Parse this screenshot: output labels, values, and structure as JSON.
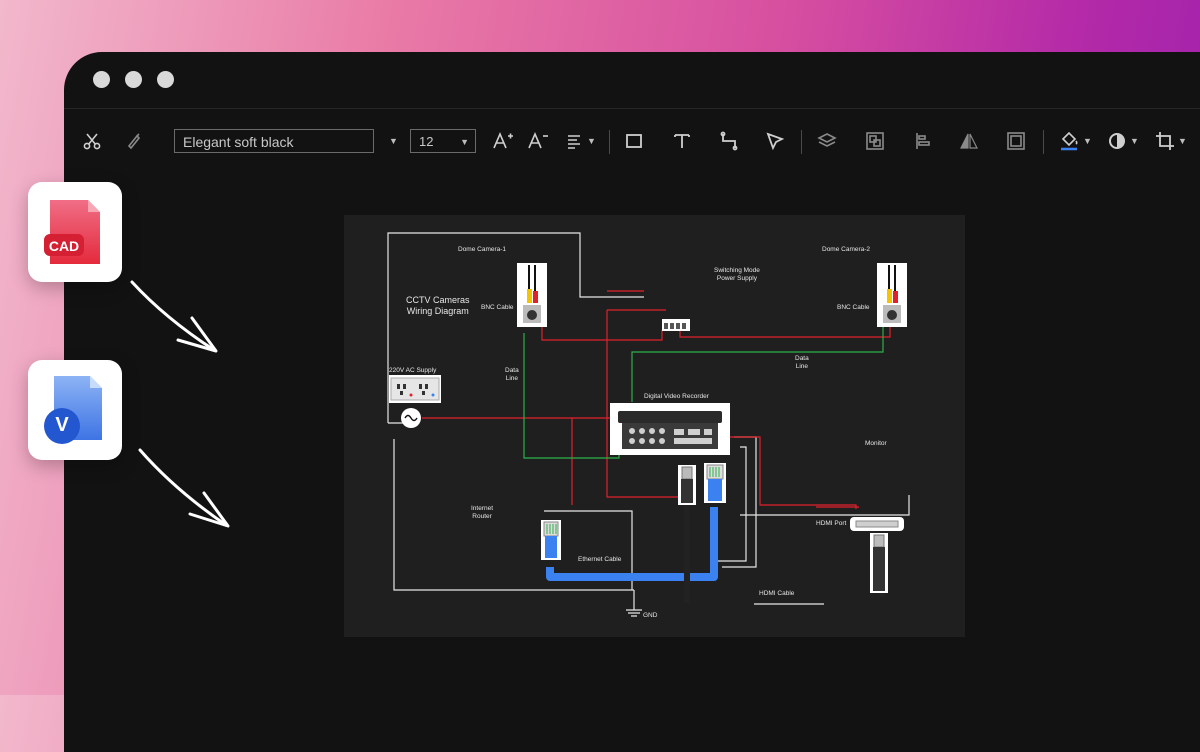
{
  "toolbar": {
    "font_name": "Elegant soft black",
    "font_size": "12",
    "icons": [
      "scissors-icon",
      "brush-icon",
      "increase-font-icon",
      "decrease-font-icon",
      "align-icon",
      "rectangle-icon",
      "text-icon",
      "connector-icon",
      "pointer-icon",
      "layers-icon",
      "group-icon",
      "align-left-icon",
      "flip-icon",
      "frame-icon",
      "fill-icon",
      "circle-style-icon",
      "crop-icon"
    ]
  },
  "file_cards": [
    {
      "label": "CAD",
      "color": "#e8283c"
    },
    {
      "label": "V",
      "color": "#2f66e0"
    }
  ],
  "diagram": {
    "title": "CCTV Cameras\nWiring Diagram",
    "labels": {
      "dome_camera_1": "Dome Camera-1",
      "dome_camera_2": "Dome Camera-2",
      "switching_mode": "Switching Mode\nPower Supply",
      "bnc_cable_1": "BNC Cable",
      "bnc_cable_2": "BNC Cable",
      "ac_supply": "220V AC Supply",
      "data_line_1": "Data\nLine",
      "data_line_2": "Data\nLine",
      "dvr": "Digital Video Recorder",
      "monitor": "Monitor",
      "internet_router": "Internet\nRouter",
      "hdmi_port": "HDMI Port",
      "ethernet_cable": "Ethernet Cable",
      "hdmi_cable": "HDMI Cable",
      "gnd": "GND"
    }
  },
  "colors": {
    "window_bg": "#121212",
    "canvas_bg": "#1f1f1f",
    "wire_white": "#e6e6e6",
    "wire_red": "#e0222a",
    "wire_green": "#2bb04a",
    "ethernet_blue": "#3b82f0"
  }
}
